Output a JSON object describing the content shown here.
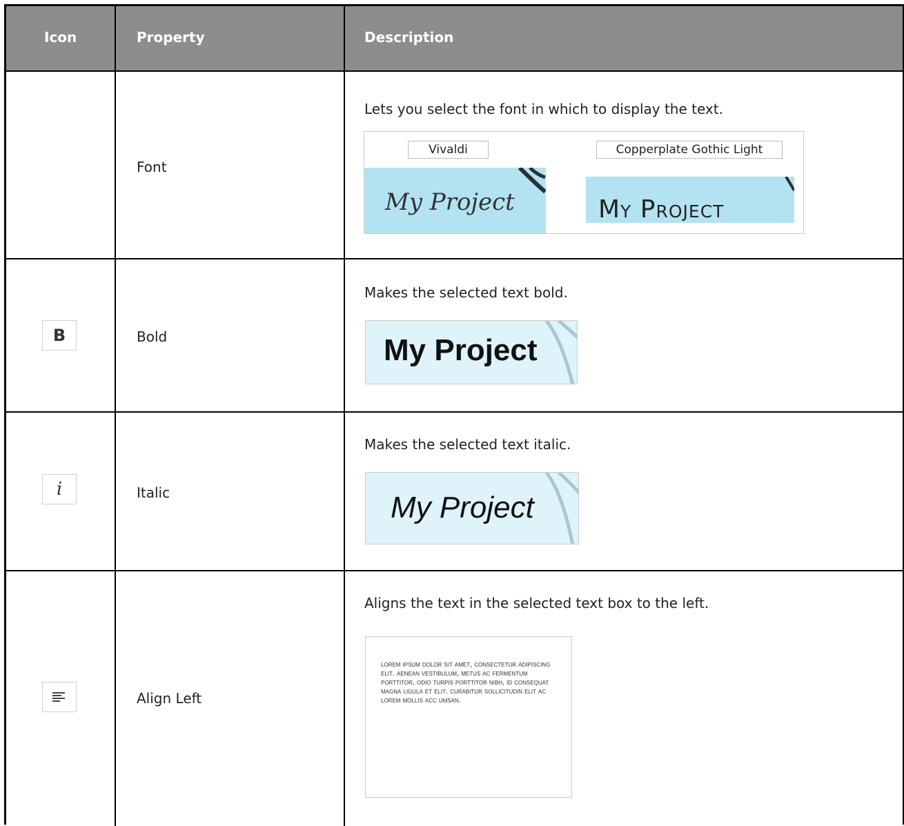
{
  "header": {
    "col_icon": "Icon",
    "col_property": "Property",
    "col_description": "Description"
  },
  "rows": [
    {
      "property": "Font",
      "description": "Lets you select the font in which to display the text.",
      "example": {
        "font_a_label": "Vivaldi",
        "font_a_sample": "My Project",
        "font_b_label": "Copperplate Gothic Light",
        "font_b_sample": "My Project"
      }
    },
    {
      "property": "Bold",
      "icon": "bold-icon",
      "icon_glyph": "B",
      "description": "Makes the selected text bold.",
      "example": {
        "sample": "My Project"
      }
    },
    {
      "property": "Italic",
      "icon": "italic-icon",
      "icon_glyph": "i",
      "description": "Makes the selected text italic.",
      "example": {
        "sample": "My Project"
      }
    },
    {
      "property": "Align Left",
      "icon": "align-left-icon",
      "description": "Aligns the text in the selected text box to the left.",
      "example": {
        "sample": "Lorem ipsum dolor sit amet, consectetur adipiscing elit. Aenean vestibulum, metus ac fermentum porttitor, odio turpis porttitor nibh, id consequat magna ligula et elit. Curabitur sollicitudin elit ac lorem mollis acc umsan."
      }
    }
  ],
  "colors": {
    "header_bg": "#8c8d8f",
    "swatch": "#b3e3f0",
    "swatch_light": "#dff3fa"
  }
}
